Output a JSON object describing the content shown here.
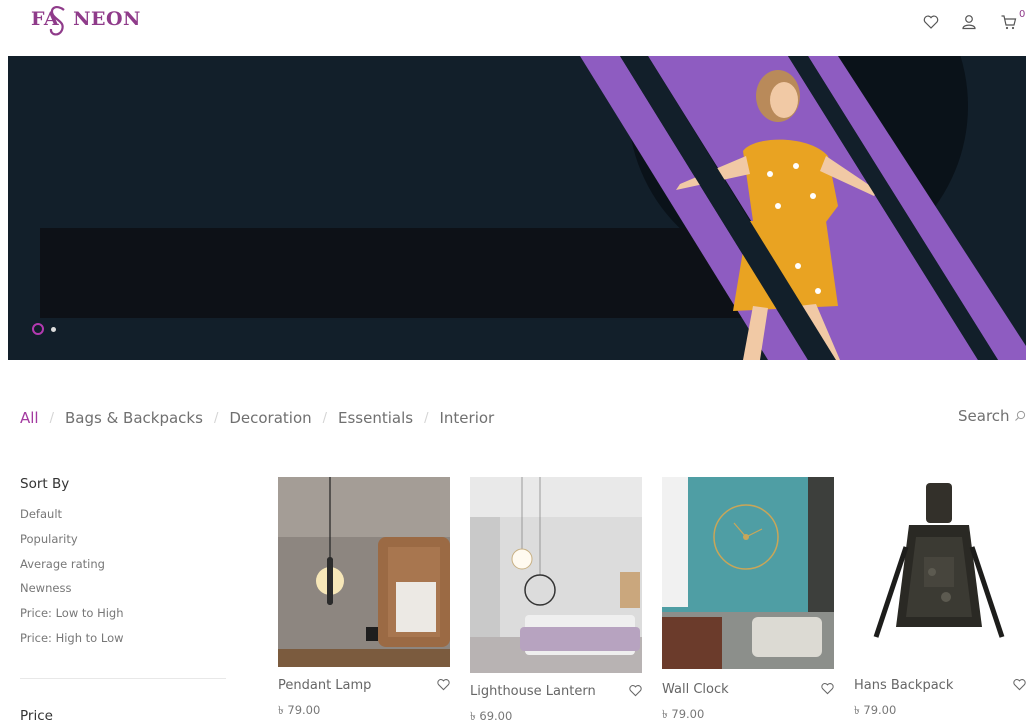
{
  "brand": {
    "logo_text": "FASNEON"
  },
  "header": {
    "icons": [
      "heart-icon",
      "user-icon",
      "cart-icon"
    ],
    "cart_count": "0"
  },
  "hero": {
    "slides": 2,
    "active_slide": 1,
    "colors": {
      "background": "#121f2a",
      "stripe": "#8e5cc1",
      "accent": "#b33ab0"
    }
  },
  "filters": {
    "categories": [
      "All",
      "Bags & Backpacks",
      "Decoration",
      "Essentials",
      "Interior"
    ],
    "active": "All",
    "search_label": "Search"
  },
  "sidebar": {
    "sort_title": "Sort By",
    "sort_options": [
      "Default",
      "Popularity",
      "Average rating",
      "Newness",
      "Price: Low to High",
      "Price: High to Low"
    ],
    "price_title": "Price"
  },
  "products": [
    {
      "name": "Pendant Lamp",
      "price": "৳ 79.00"
    },
    {
      "name": "Lighthouse Lantern",
      "price": "৳ 69.00"
    },
    {
      "name": "Wall Clock",
      "price": "৳ 79.00"
    },
    {
      "name": "Hans Backpack",
      "price": "৳ 79.00"
    }
  ]
}
